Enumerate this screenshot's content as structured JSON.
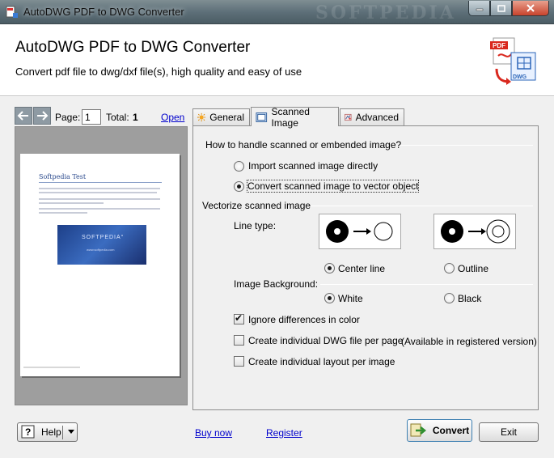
{
  "window": {
    "title": "AutoDWG PDF to DWG Converter",
    "watermark": "SOFTPEDIA"
  },
  "header": {
    "title": "AutoDWG PDF to DWG Converter",
    "subtitle": "Convert pdf file to dwg/dxf file(s), high quality and easy  of use"
  },
  "preview": {
    "page_label": "Page:",
    "page_value": "1",
    "total_label": "Total:",
    "total_value": "1",
    "open_label": "Open",
    "doc_title": "Softpedia Test",
    "banner_text": "SOFTPEDIA°",
    "banner_url": "www.softpedia.com"
  },
  "tabs": [
    {
      "label": "General",
      "icon": "sun-icon"
    },
    {
      "label": "Scanned Image",
      "icon": "scanner-icon"
    },
    {
      "label": "Advanced",
      "icon": "advanced-icon"
    }
  ],
  "scanned": {
    "question": "How to handle scanned or embended image?",
    "opt_import": "Import scanned image directly",
    "opt_convert": "Convert scanned image to vector object",
    "vectorize_heading": "Vectorize scanned image",
    "line_type_label": "Line type:",
    "center_line": "Center line",
    "outline": "Outline",
    "background_label": "Image Background:",
    "white": "White",
    "black": "Black",
    "ignore_colors": "Ignore differences in color",
    "individual_dwg": "Create individual DWG file per page",
    "registered_note": "(Available in registered version)",
    "individual_layout": "Create  individual layout per image",
    "selected_handling": "Convert scanned image to vector object",
    "selected_line_type": "Center line",
    "selected_background": "White",
    "ignore_colors_checked": true,
    "individual_dwg_checked": false,
    "individual_layout_checked": false
  },
  "bottom": {
    "help": "Help",
    "buy_now": "Buy now",
    "register": "Register",
    "convert": "Convert",
    "exit": "Exit"
  },
  "colors": {
    "link": "#0000cc",
    "titlebar": "#5e7079",
    "panel": "#f0f0f0"
  }
}
